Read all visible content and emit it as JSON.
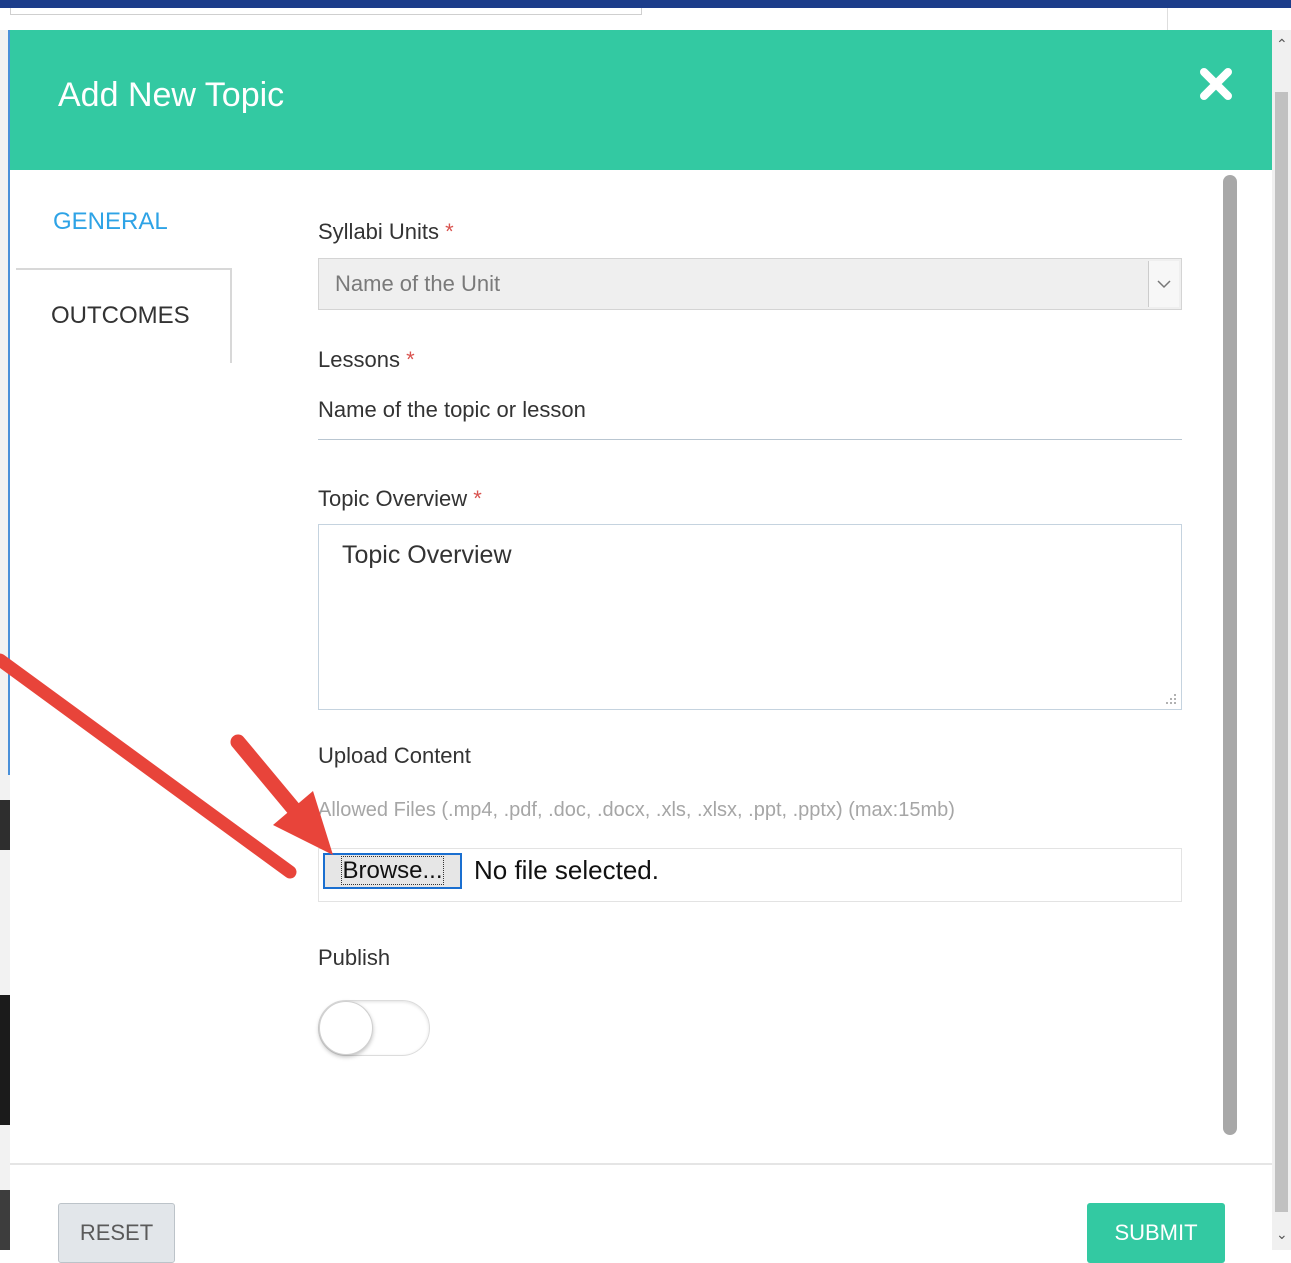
{
  "modal": {
    "title": "Add New Topic",
    "close_icon": "close-icon"
  },
  "tabs": [
    {
      "label": "GENERAL",
      "active": true
    },
    {
      "label": "OUTCOMES",
      "active": false
    }
  ],
  "form": {
    "syllabi_units": {
      "label": "Syllabi Units",
      "required_mark": "*",
      "value": "Name of the Unit"
    },
    "lessons": {
      "label": "Lessons",
      "required_mark": "*",
      "value": "Name of the topic or lesson"
    },
    "topic_overview": {
      "label": "Topic Overview",
      "required_mark": "*",
      "value": "Topic Overview"
    },
    "upload": {
      "label": "Upload Content",
      "hint": "Allowed Files (.mp4, .pdf, .doc, .docx, .xls, .xlsx, .ppt, .pptx) (max:15mb)",
      "browse_label": "Browse...",
      "file_status": "No file selected."
    },
    "publish": {
      "label": "Publish",
      "on": false
    }
  },
  "footer": {
    "reset_label": "RESET",
    "submit_label": "SUBMIT"
  },
  "colors": {
    "accent": "#33c9a2",
    "active_tab": "#2ea3e6",
    "required": "#d9534f",
    "annotation_arrow": "#e8443a"
  }
}
